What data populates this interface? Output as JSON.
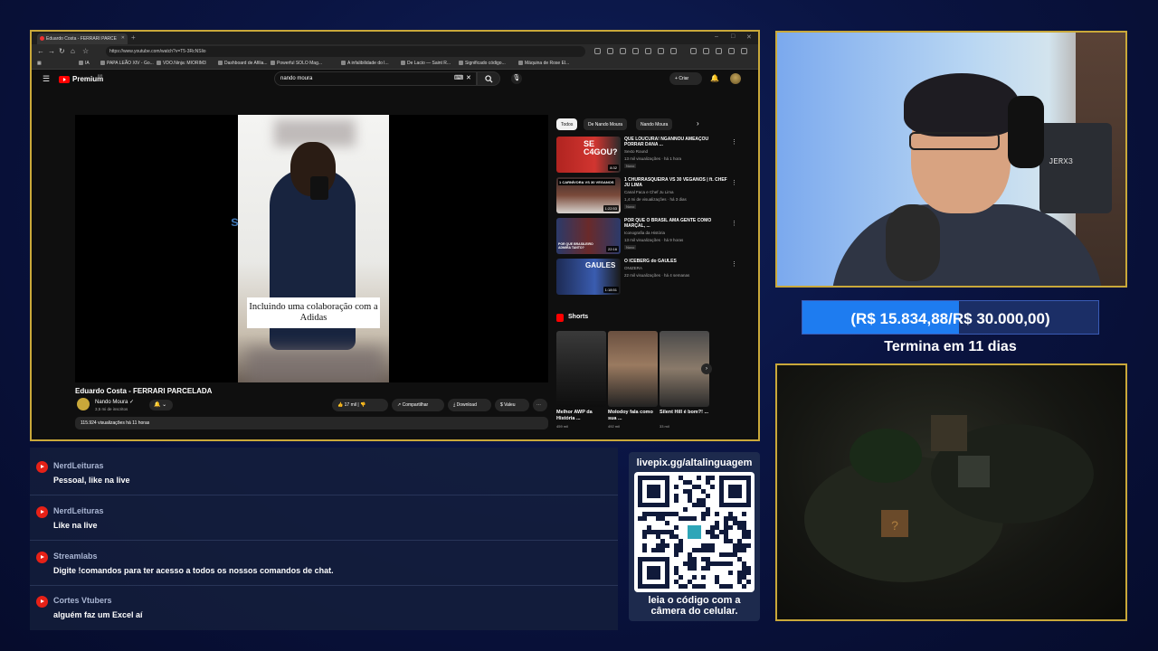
{
  "browser": {
    "tab_title": "Eduardo Costa - FERRARI PARCE",
    "url": "https://www.youtube.com/watch?v=T5-3RcNSlio",
    "bookmarks": [
      "IA",
      "PAPA LEÃO XIV - Go...",
      "VDO.Ninja: MIORIM3",
      "Dashboard de Afilia...",
      "Powerful SOLO Mag...",
      "A infalibilidade do l...",
      "De Lacio — Saint R...",
      "Significado código...",
      "Máquina de Rose El..."
    ]
  },
  "youtube": {
    "brand": "Premium",
    "brand_sup": "BR",
    "search_query": "nando moura",
    "create_label": "Criar",
    "video_caption": "Incluindo uma colaboração com a Adidas",
    "video_title": "Eduardo Costa - FERRARI PARCELADA",
    "channel_name": "Nando Moura",
    "channel_subs": "3,5 mi de inscritos",
    "likes": "17 mil",
    "share": "Compartilhar",
    "download": "Download",
    "thanks": "Valeu",
    "views_line": "115.924 visualizações  há 11 horas",
    "chips": [
      "Todos",
      "De Nando Moura",
      "Nando Moura"
    ],
    "recommendations": [
      {
        "title": "QUE LOUCURA! NGANNOU AMEAÇOU PORRAR DANA ...",
        "channel": "Sexto Round",
        "meta": "13 mil visualizações · há 1 hora",
        "badge": "Novo",
        "duration": "8:32",
        "thumb_text": "SE C4GOU?"
      },
      {
        "title": "1 CHURRASQUEIRA VS 30 VEGANOS | ft. CHEF JU LIMA",
        "channel": "Canal Faca e Chef Ju Lima",
        "meta": "1,4 mi de visualizações · há 3 dias",
        "badge": "Novo",
        "duration": "1:22:53",
        "thumb_text": "1 CARNÍVORA VS 30 VEGANOS"
      },
      {
        "title": "POR QUE O BRASIL AMA GENTE COMO MARÇAL, ...",
        "channel": "Iconografia da História",
        "meta": "13 mil visualizações · há 9 horas",
        "badge": "Novo",
        "duration": "22:16",
        "thumb_text": "POR QUE BRASILEIRO ADMIRA TANTO?"
      },
      {
        "title": "O ICEBERG do GAULES",
        "channel": "ONIZERA",
        "meta": "22 mil visualizações · há 4 semanas",
        "badge": "",
        "duration": "1:18:51",
        "thumb_text": "GAULES"
      }
    ],
    "shorts_label": "Shorts",
    "shorts": [
      {
        "title": "Melhor AWP da História ...",
        "views": "459 mil"
      },
      {
        "title": "Molodoy fala como sua ...",
        "views": "492 mil"
      },
      {
        "title": "Silent Hill é bom?! ...",
        "views": "33 mil"
      }
    ]
  },
  "webcam": {
    "chair_text": "JERX3"
  },
  "goal": {
    "text": "(R$ 15.834,88/R$ 30.000,00)",
    "progress": 0.528,
    "subtitle": "Termina em 11 dias"
  },
  "chat": [
    {
      "user": "NerdLeituras",
      "text": "Pessoal, like na live"
    },
    {
      "user": "NerdLeituras",
      "text": "Like na live"
    },
    {
      "user": "Streamlabs",
      "text": "Digite !comandos para ter acesso a todos os nossos comandos de chat."
    },
    {
      "user": "Cortes Vtubers",
      "text": "alguém faz um Excel aí"
    }
  ],
  "qr": {
    "url": "livepix.gg/altalinguagem",
    "caption_line1": "leia o código com a",
    "caption_line2": "câmera do celular."
  },
  "colors": {
    "accent_gold": "#c9a83a",
    "goal_fill": "#1e7cf0",
    "youtube_red": "#ff0000"
  }
}
